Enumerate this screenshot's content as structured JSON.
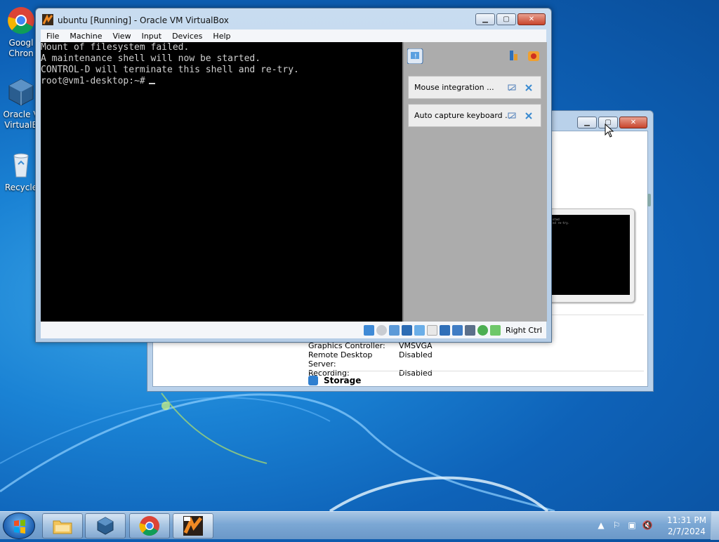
{
  "desktop": {
    "icons": [
      {
        "label_line1": "Googl",
        "label_line2": "Chron"
      },
      {
        "label_line1": "Oracle V",
        "label_line2": "VirtualB"
      },
      {
        "label_line1": "Recycle",
        "label_line2": ""
      }
    ]
  },
  "bg_window": {
    "details": [
      {
        "key": "Graphics Controller:",
        "value": "VMSVGA"
      },
      {
        "key": "Remote Desktop Server:",
        "value": "Disabled"
      },
      {
        "key": "Recording:",
        "value": "Disabled"
      }
    ],
    "storage_label": "Storage",
    "preview_lines": [
      "nted",
      "nd re-try."
    ]
  },
  "vm_window": {
    "title": "ubuntu [Running] - Oracle VM VirtualBox",
    "menu": [
      "File",
      "Machine",
      "View",
      "Input",
      "Devices",
      "Help"
    ],
    "console_lines": [
      "Mount of filesystem failed.",
      "A maintenance shell will now be started.",
      "CONTROL-D will terminate this shell and re-try.",
      "root@vm1-desktop:~#"
    ],
    "notifications": [
      {
        "text": "Mouse integration ..."
      },
      {
        "text": "Auto capture keyboard ..."
      }
    ],
    "host_key": "Right Ctrl"
  },
  "taskbar": {
    "clock_time": "11:31 PM",
    "clock_date": "2/7/2024"
  },
  "colors": {
    "console_bg": "#000000",
    "console_fg": "#cfcfcf",
    "notify_bg": "#acacac",
    "taskbar": "#7ba7d4"
  }
}
